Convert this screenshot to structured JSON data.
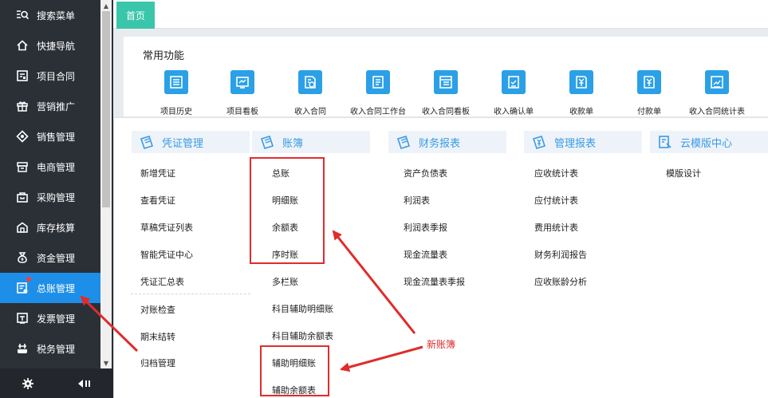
{
  "sidebar": {
    "items": [
      {
        "label": "搜索菜单",
        "icon": "search-menu-icon"
      },
      {
        "label": "快捷导航",
        "icon": "home-icon"
      },
      {
        "label": "项目合同",
        "icon": "contract-icon"
      },
      {
        "label": "营销推广",
        "icon": "gift-icon"
      },
      {
        "label": "销售管理",
        "icon": "sales-icon"
      },
      {
        "label": "电商管理",
        "icon": "store-icon"
      },
      {
        "label": "采购管理",
        "icon": "bag-icon"
      },
      {
        "label": "库存核算",
        "icon": "warehouse-icon"
      },
      {
        "label": "资金管理",
        "icon": "money-bag-icon"
      },
      {
        "label": "总账管理",
        "icon": "ledger-icon"
      },
      {
        "label": "发票管理",
        "icon": "invoice-icon"
      },
      {
        "label": "税务管理",
        "icon": "tax-icon"
      }
    ],
    "active_index": 9
  },
  "tabs": {
    "home": "首页"
  },
  "common": {
    "title": "常用功能",
    "items": [
      {
        "label": "项目历史",
        "icon": "list-icon"
      },
      {
        "label": "项目看板",
        "icon": "chart-board-icon"
      },
      {
        "label": "收入合同",
        "icon": "document-clock-icon"
      },
      {
        "label": "收入合同工作台",
        "icon": "workbench-icon"
      },
      {
        "label": "收入合同看板",
        "icon": "board-icon"
      },
      {
        "label": "收入确认单",
        "icon": "check-doc-icon"
      },
      {
        "label": "收款单",
        "icon": "receipt-icon"
      },
      {
        "label": "付款单",
        "icon": "payment-icon"
      },
      {
        "label": "收入合同统计表",
        "icon": "stats-icon"
      }
    ]
  },
  "menu": {
    "voucher": {
      "title": "凭证管理",
      "links": [
        "新增凭证",
        "查看凭证",
        "草稿凭证列表",
        "智能凭证中心",
        "凭证汇总表",
        "对账检查",
        "期末结转",
        "归档管理"
      ]
    },
    "ledger": {
      "title": "账簿",
      "links": [
        "总账",
        "明细账",
        "余额表",
        "序时账",
        "多栏账",
        "科目辅助明细账",
        "科目辅助余额表",
        "辅助明细账",
        "辅助余额表"
      ]
    },
    "finance": {
      "title": "财务报表",
      "links": [
        "资产负债表",
        "利润表",
        "利润表季报",
        "现金流量表",
        "现金流量表季报"
      ]
    },
    "management": {
      "title": "管理报表",
      "links": [
        "应收统计表",
        "应付统计表",
        "费用统计表",
        "财务利润报告",
        "应收账龄分析"
      ]
    },
    "cloud": {
      "title": "云模版中心",
      "links": [
        "模版设计"
      ]
    }
  },
  "annotation": {
    "text": "新账簿"
  },
  "colors": {
    "sidebar_bg": "#2b3037",
    "active": "#1e8fe8",
    "accent_teal": "#3ac6ab",
    "icon_blue": "#2ba0e6",
    "annotation_red": "#e02c2c"
  }
}
